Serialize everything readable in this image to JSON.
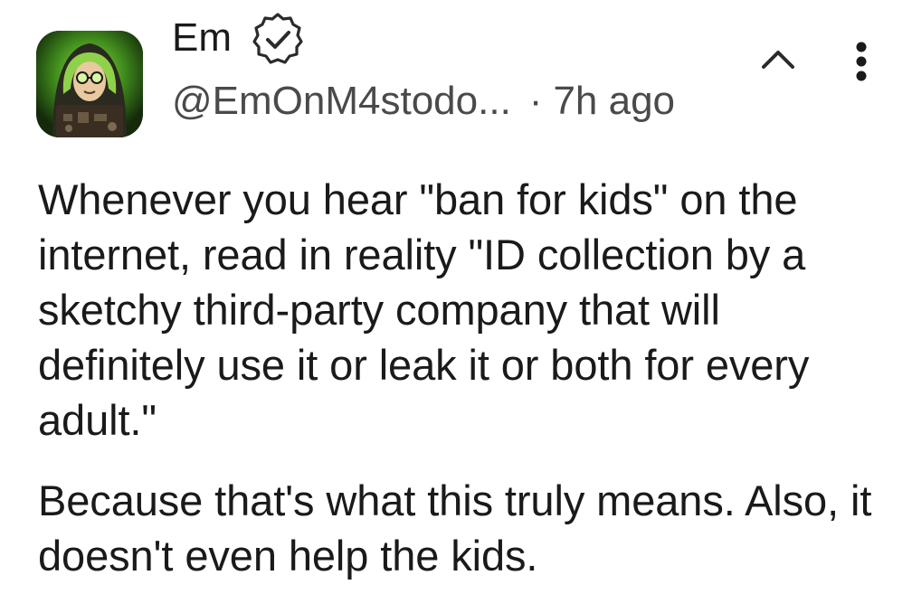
{
  "author": {
    "display_name": "Em",
    "handle": "@EmOnM4stodo...",
    "timestamp": "7h ago",
    "separator": "·",
    "verified_icon": "verified-badge-icon",
    "avatar_icon": "avatar-hooded-figure"
  },
  "post": {
    "paragraphs": [
      "Whenever you hear \"ban for kids\" on the internet, read in reality \"ID collection by a sketchy third-party company that will definitely use it or leak it or both for every adult.\"",
      "Because that's what this truly means. Also, it doesn't even help the kids."
    ]
  },
  "actions": {
    "collapse_icon": "chevron-up-icon",
    "more_icon": "more-vertical-icon"
  },
  "colors": {
    "text": "#1a1a1a",
    "secondary_text": "#4a4a4a",
    "avatar_green": "#4caf2a",
    "background": "#ffffff"
  }
}
